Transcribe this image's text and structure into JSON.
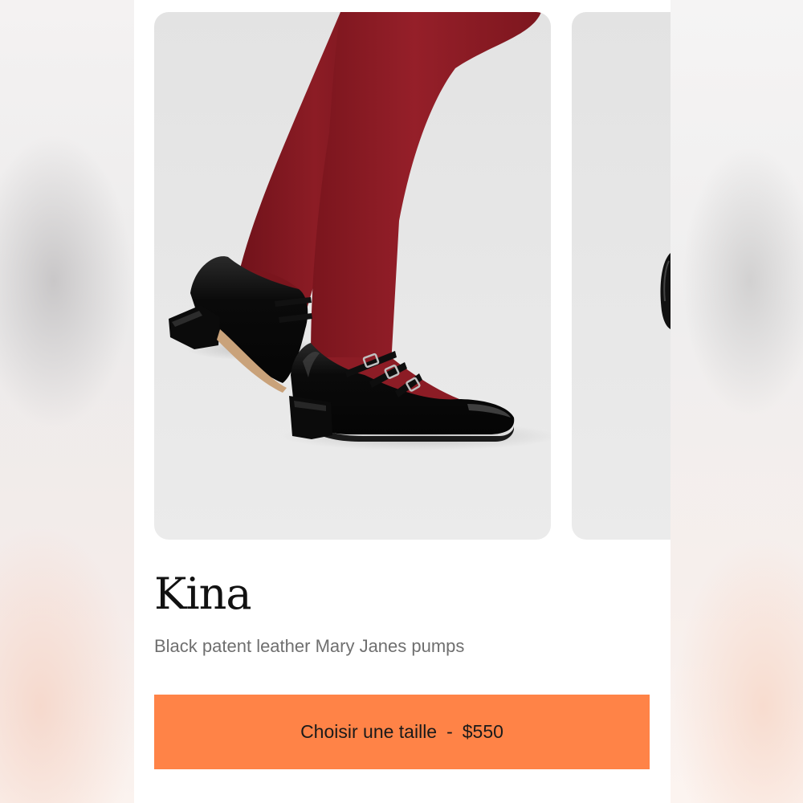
{
  "product": {
    "name": "Kina",
    "description": "Black patent leather Mary Janes pumps"
  },
  "cta": {
    "label": "Choisir une taille",
    "separator": "-",
    "price": "$550"
  },
  "colors": {
    "accent": "#ff8347",
    "tights": "#8a1a22",
    "shoe": "#0d0d0d"
  },
  "gallery": {
    "main_image": "black patent mary jane pumps worn with burgundy tights",
    "next_image": "next product photo (partially visible)"
  }
}
